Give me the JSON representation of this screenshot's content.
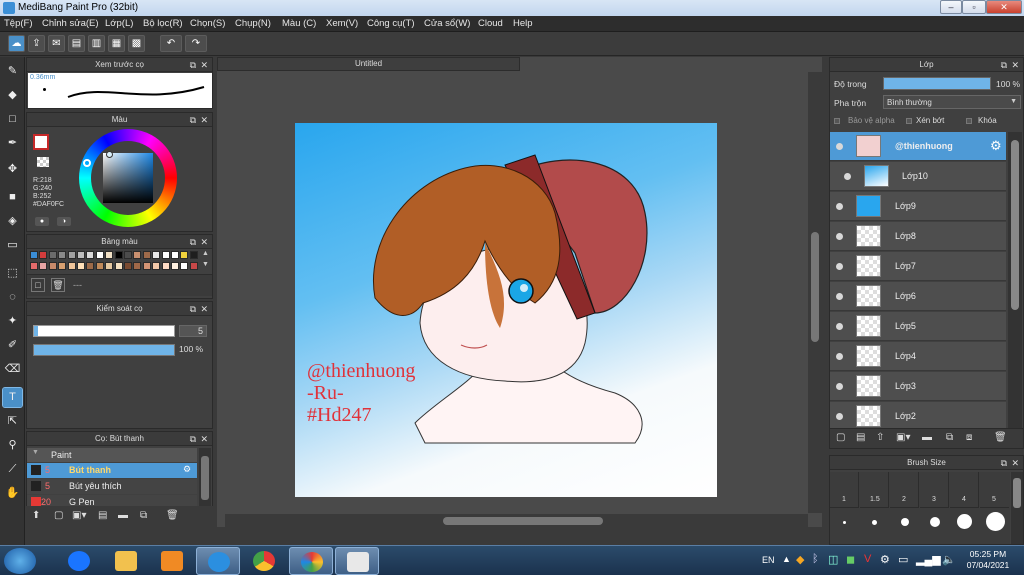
{
  "window": {
    "title": "MediBang Paint Pro (32bit)",
    "minimize": "–",
    "maximize": "▫",
    "close": "✕"
  },
  "menu": [
    "Tệp(F)",
    "Chỉnh sửa(E)",
    "Lớp(L)",
    "Bộ lọc(R)",
    "Chọn(S)",
    "Chụp(N)",
    "Màu (C)",
    "Xem(V)",
    "Công cụ(T)",
    "Cửa sổ(W)",
    "Cloud",
    "Help"
  ],
  "toolbar_icons": [
    "cloud-icon",
    "share-icon",
    "comment-icon",
    "document-icon",
    "page-icon",
    "gallery-icon",
    "grid-icon",
    "undo-icon",
    "redo-icon"
  ],
  "tools_icons": [
    "brush-icon",
    "eraser-icon",
    "rectangle-select-icon",
    "pen-icon",
    "move-icon",
    "fill-rect-icon",
    "bucket-icon",
    "gradient-icon",
    "dotted-select-icon",
    "lasso-icon",
    "magic-wand-icon",
    "select-pen-icon",
    "select-eraser-icon",
    "text-icon",
    "operation-icon",
    "eyedropper-icon",
    "divide-icon",
    "hand-icon"
  ],
  "brush_preview": {
    "title": "Xem trước cọ",
    "size": "0.36mm"
  },
  "color_panel": {
    "title": "Màu",
    "r": "R:218",
    "g": "G:240",
    "b": "B:252",
    "hex": "#DAF0FC",
    "foreground": "#c62828",
    "background": "#ffffff"
  },
  "palette": {
    "title": "Bảng màu",
    "row1": [
      "#3a8dd6",
      "#d33c3c",
      "#6b6b6b",
      "#8a8a8a",
      "#a2a2a2",
      "#bdbdbd",
      "#d9d9d9",
      "#ffffff",
      "#f2e1c6",
      "#000000",
      "#4b4b4b",
      "#c99070",
      "#9e6a4a",
      "#e8e8e8",
      "#ffffff",
      "#ffffff",
      "#f1d23c",
      "#1e1e1e"
    ],
    "row2": [
      "#e36a6a",
      "#e8a5a5",
      "#c98a6a",
      "#d8a070",
      "#f0c59a",
      "#ffe0b8",
      "#9c6a48",
      "#c08a5a",
      "#e5c8a0",
      "#f5e0c0",
      "#7a4a30",
      "#a06848",
      "#d49474",
      "#f2c8a8",
      "#ffdcc6",
      "#fff0e0",
      "#ffffff",
      "#c84848"
    ],
    "placeholder": "---"
  },
  "brush_control": {
    "title": "Kiểm soát cọ",
    "size_value": "5",
    "size_fraction": 0.03,
    "opacity_value": "100 %",
    "opacity_fraction": 1.0
  },
  "brush_list": {
    "title": "Cọ: Bút thanh",
    "group": "Paint",
    "items": [
      {
        "size": "5",
        "name": "Bút thanh",
        "selected": true
      },
      {
        "size": "5",
        "name": "Bút yêu thích",
        "selected": false
      },
      {
        "size": "20",
        "name": "G Pen",
        "selected": false
      }
    ]
  },
  "document": {
    "tab": "Untitled",
    "watermark_lines": [
      "@thienhuong",
      "-Ru-",
      "#Hd247"
    ]
  },
  "layer_panel": {
    "title": "Lớp",
    "opacity_label": "Độ trong",
    "opacity_value": "100 %",
    "opacity_fraction": 1.0,
    "blend_label": "Pha trộn",
    "blend_value": "Bình thường",
    "protect_alpha": "Bảo vệ alpha",
    "clipping": "Xén bớt",
    "lock": "Khóa",
    "layers": [
      {
        "name": "@thienhuong",
        "selected": true
      },
      {
        "name": "Lớp10",
        "selected": false
      },
      {
        "name": "Lớp9",
        "selected": false
      },
      {
        "name": "Lớp8",
        "selected": false
      },
      {
        "name": "Lớp7",
        "selected": false
      },
      {
        "name": "Lớp6",
        "selected": false
      },
      {
        "name": "Lớp5",
        "selected": false
      },
      {
        "name": "Lớp4",
        "selected": false
      },
      {
        "name": "Lớp3",
        "selected": false
      },
      {
        "name": "Lớp2",
        "selected": false
      }
    ]
  },
  "brush_size_panel": {
    "title": "Brush Size",
    "sizes": [
      "1",
      "1.5",
      "2",
      "3",
      "4",
      "5"
    ]
  },
  "taskbar": {
    "apps": [
      "start-button",
      "zalo-icon",
      "file-explorer-icon",
      "media-player-icon",
      "internet-explorer-icon",
      "chrome-icon",
      "medibang-icon",
      "snipping-tool-icon"
    ],
    "lang": "EN",
    "time": "05:25 PM",
    "date": "07/04/2021"
  }
}
